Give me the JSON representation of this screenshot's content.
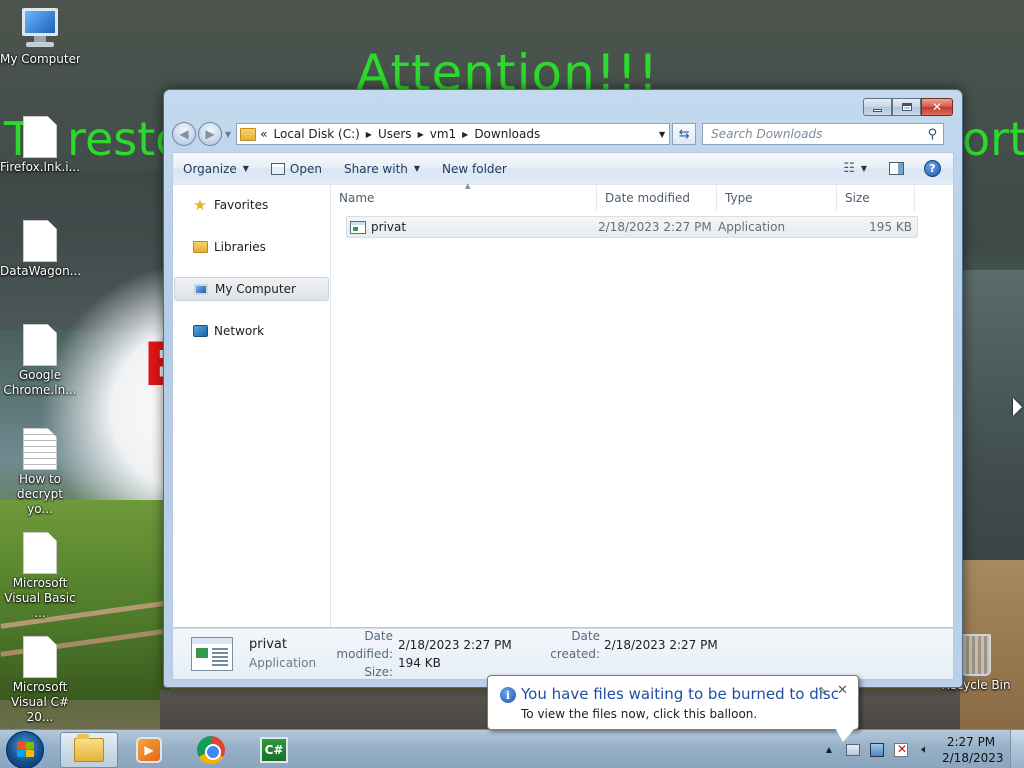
{
  "wallpaper": {
    "title": "Attention!!!",
    "line2_left": "To resto",
    "line2_right": "ort",
    "red_letter": "E"
  },
  "desktop": {
    "icons": [
      {
        "label": "My Computer",
        "icon": "computer-icon"
      },
      {
        "label": "Firefox.lnk.i...",
        "icon": "document-icon"
      },
      {
        "label": "DataWagon....",
        "icon": "document-icon"
      },
      {
        "label": "Google Chrome.ln...",
        "icon": "document-icon"
      },
      {
        "label": "How to decrypt yo...",
        "icon": "text-document-icon"
      },
      {
        "label": "Microsoft Visual Basic ...",
        "icon": "document-icon"
      },
      {
        "label": "Microsoft Visual C# 20...",
        "icon": "document-icon"
      },
      {
        "label": "Recycle Bin",
        "icon": "recycle-bin-icon"
      }
    ]
  },
  "explorer": {
    "address": {
      "overflow": "«",
      "crumbs": [
        "Local Disk (C:)",
        "Users",
        "vm1",
        "Downloads"
      ]
    },
    "search_placeholder": "Search Downloads",
    "toolbar": {
      "organize": "Organize",
      "open": "Open",
      "share_with": "Share with",
      "new_folder": "New folder"
    },
    "nav": {
      "favorites": "Favorites",
      "libraries": "Libraries",
      "my_computer": "My Computer",
      "network": "Network"
    },
    "columns": {
      "name": "Name",
      "date_modified": "Date modified",
      "type": "Type",
      "size": "Size"
    },
    "files": [
      {
        "name": "privat",
        "date_modified": "2/18/2023 2:27 PM",
        "type": "Application",
        "size": "195 KB"
      }
    ],
    "details": {
      "name": "privat",
      "type": "Application",
      "date_modified_label": "Date modified:",
      "date_modified": "2/18/2023 2:27 PM",
      "size_label": "Size:",
      "size": "194 KB",
      "date_created_label": "Date created:",
      "date_created": "2/18/2023 2:27 PM"
    }
  },
  "balloon": {
    "title": "You have files waiting to be burned to disc",
    "text": "To view the files now, click this balloon."
  },
  "taskbar": {
    "clock_time": "2:27 PM",
    "clock_date": "2/18/2023",
    "cs_label": "C#"
  },
  "colors": {
    "accent_text": "#1e4fa0",
    "wallpaper_text": "#2cd92c",
    "close_button": "#c13a2c"
  }
}
